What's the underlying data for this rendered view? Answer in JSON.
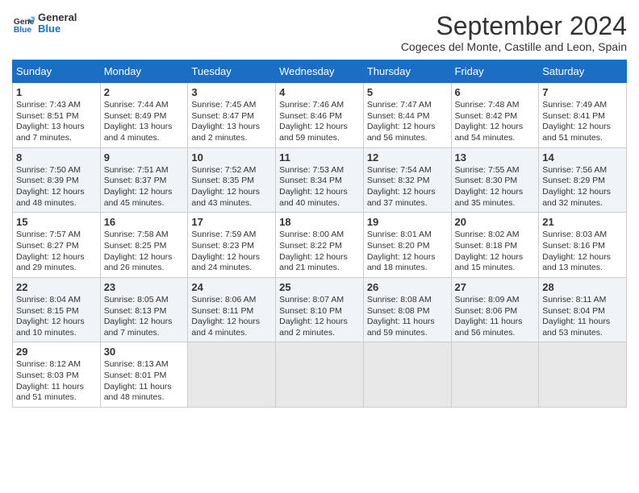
{
  "header": {
    "logo_line1": "General",
    "logo_line2": "Blue",
    "month_title": "September 2024",
    "subtitle": "Cogeces del Monte, Castille and Leon, Spain"
  },
  "days_of_week": [
    "Sunday",
    "Monday",
    "Tuesday",
    "Wednesday",
    "Thursday",
    "Friday",
    "Saturday"
  ],
  "weeks": [
    [
      {
        "day": "1",
        "sunrise": "Sunrise: 7:43 AM",
        "sunset": "Sunset: 8:51 PM",
        "daylight": "Daylight: 13 hours and 7 minutes."
      },
      {
        "day": "2",
        "sunrise": "Sunrise: 7:44 AM",
        "sunset": "Sunset: 8:49 PM",
        "daylight": "Daylight: 13 hours and 4 minutes."
      },
      {
        "day": "3",
        "sunrise": "Sunrise: 7:45 AM",
        "sunset": "Sunset: 8:47 PM",
        "daylight": "Daylight: 13 hours and 2 minutes."
      },
      {
        "day": "4",
        "sunrise": "Sunrise: 7:46 AM",
        "sunset": "Sunset: 8:46 PM",
        "daylight": "Daylight: 12 hours and 59 minutes."
      },
      {
        "day": "5",
        "sunrise": "Sunrise: 7:47 AM",
        "sunset": "Sunset: 8:44 PM",
        "daylight": "Daylight: 12 hours and 56 minutes."
      },
      {
        "day": "6",
        "sunrise": "Sunrise: 7:48 AM",
        "sunset": "Sunset: 8:42 PM",
        "daylight": "Daylight: 12 hours and 54 minutes."
      },
      {
        "day": "7",
        "sunrise": "Sunrise: 7:49 AM",
        "sunset": "Sunset: 8:41 PM",
        "daylight": "Daylight: 12 hours and 51 minutes."
      }
    ],
    [
      {
        "day": "8",
        "sunrise": "Sunrise: 7:50 AM",
        "sunset": "Sunset: 8:39 PM",
        "daylight": "Daylight: 12 hours and 48 minutes."
      },
      {
        "day": "9",
        "sunrise": "Sunrise: 7:51 AM",
        "sunset": "Sunset: 8:37 PM",
        "daylight": "Daylight: 12 hours and 45 minutes."
      },
      {
        "day": "10",
        "sunrise": "Sunrise: 7:52 AM",
        "sunset": "Sunset: 8:35 PM",
        "daylight": "Daylight: 12 hours and 43 minutes."
      },
      {
        "day": "11",
        "sunrise": "Sunrise: 7:53 AM",
        "sunset": "Sunset: 8:34 PM",
        "daylight": "Daylight: 12 hours and 40 minutes."
      },
      {
        "day": "12",
        "sunrise": "Sunrise: 7:54 AM",
        "sunset": "Sunset: 8:32 PM",
        "daylight": "Daylight: 12 hours and 37 minutes."
      },
      {
        "day": "13",
        "sunrise": "Sunrise: 7:55 AM",
        "sunset": "Sunset: 8:30 PM",
        "daylight": "Daylight: 12 hours and 35 minutes."
      },
      {
        "day": "14",
        "sunrise": "Sunrise: 7:56 AM",
        "sunset": "Sunset: 8:29 PM",
        "daylight": "Daylight: 12 hours and 32 minutes."
      }
    ],
    [
      {
        "day": "15",
        "sunrise": "Sunrise: 7:57 AM",
        "sunset": "Sunset: 8:27 PM",
        "daylight": "Daylight: 12 hours and 29 minutes."
      },
      {
        "day": "16",
        "sunrise": "Sunrise: 7:58 AM",
        "sunset": "Sunset: 8:25 PM",
        "daylight": "Daylight: 12 hours and 26 minutes."
      },
      {
        "day": "17",
        "sunrise": "Sunrise: 7:59 AM",
        "sunset": "Sunset: 8:23 PM",
        "daylight": "Daylight: 12 hours and 24 minutes."
      },
      {
        "day": "18",
        "sunrise": "Sunrise: 8:00 AM",
        "sunset": "Sunset: 8:22 PM",
        "daylight": "Daylight: 12 hours and 21 minutes."
      },
      {
        "day": "19",
        "sunrise": "Sunrise: 8:01 AM",
        "sunset": "Sunset: 8:20 PM",
        "daylight": "Daylight: 12 hours and 18 minutes."
      },
      {
        "day": "20",
        "sunrise": "Sunrise: 8:02 AM",
        "sunset": "Sunset: 8:18 PM",
        "daylight": "Daylight: 12 hours and 15 minutes."
      },
      {
        "day": "21",
        "sunrise": "Sunrise: 8:03 AM",
        "sunset": "Sunset: 8:16 PM",
        "daylight": "Daylight: 12 hours and 13 minutes."
      }
    ],
    [
      {
        "day": "22",
        "sunrise": "Sunrise: 8:04 AM",
        "sunset": "Sunset: 8:15 PM",
        "daylight": "Daylight: 12 hours and 10 minutes."
      },
      {
        "day": "23",
        "sunrise": "Sunrise: 8:05 AM",
        "sunset": "Sunset: 8:13 PM",
        "daylight": "Daylight: 12 hours and 7 minutes."
      },
      {
        "day": "24",
        "sunrise": "Sunrise: 8:06 AM",
        "sunset": "Sunset: 8:11 PM",
        "daylight": "Daylight: 12 hours and 4 minutes."
      },
      {
        "day": "25",
        "sunrise": "Sunrise: 8:07 AM",
        "sunset": "Sunset: 8:10 PM",
        "daylight": "Daylight: 12 hours and 2 minutes."
      },
      {
        "day": "26",
        "sunrise": "Sunrise: 8:08 AM",
        "sunset": "Sunset: 8:08 PM",
        "daylight": "Daylight: 11 hours and 59 minutes."
      },
      {
        "day": "27",
        "sunrise": "Sunrise: 8:09 AM",
        "sunset": "Sunset: 8:06 PM",
        "daylight": "Daylight: 11 hours and 56 minutes."
      },
      {
        "day": "28",
        "sunrise": "Sunrise: 8:11 AM",
        "sunset": "Sunset: 8:04 PM",
        "daylight": "Daylight: 11 hours and 53 minutes."
      }
    ],
    [
      {
        "day": "29",
        "sunrise": "Sunrise: 8:12 AM",
        "sunset": "Sunset: 8:03 PM",
        "daylight": "Daylight: 11 hours and 51 minutes."
      },
      {
        "day": "30",
        "sunrise": "Sunrise: 8:13 AM",
        "sunset": "Sunset: 8:01 PM",
        "daylight": "Daylight: 11 hours and 48 minutes."
      },
      null,
      null,
      null,
      null,
      null
    ]
  ]
}
